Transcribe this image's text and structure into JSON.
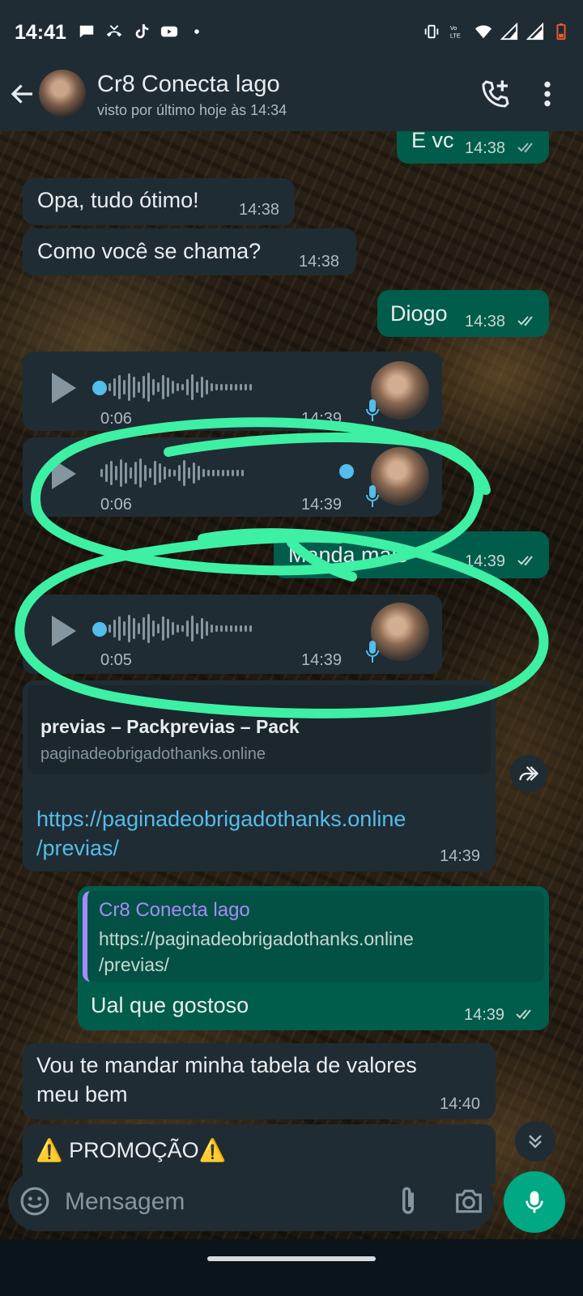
{
  "status_bar": {
    "time": "14:41"
  },
  "header": {
    "contact_name": "Cr8 Conecta lago",
    "last_seen": "visto por último hoje às 14:34"
  },
  "messages": {
    "m1": {
      "text": "E vc",
      "time": "14:38"
    },
    "m2": {
      "text": "Opa, tudo ótimo!",
      "time": "14:38"
    },
    "m3": {
      "text": "Como você se chama?",
      "time": "14:38"
    },
    "m4": {
      "text": "Diogo",
      "time": "14:38"
    },
    "v1": {
      "duration": "0:06",
      "time": "14:39",
      "played_fraction": 0
    },
    "v2": {
      "duration": "0:06",
      "time": "14:39",
      "played_fraction": 1
    },
    "m5": {
      "text": "Manda mais",
      "time": "14:39"
    },
    "v3": {
      "duration": "0:05",
      "time": "14:39",
      "played_fraction": 0
    },
    "link": {
      "preview_title": "previas – Packprevias – Pack",
      "preview_domain": "paginadeobrigadothanks.online",
      "url_line1": "https://paginadeobrigadothanks.online",
      "url_line2": "/previas/",
      "time": "14:39"
    },
    "reply": {
      "quoted_author": "Cr8 Conecta lago",
      "quoted_line1": "https://paginadeobrigadothanks.online",
      "quoted_line2": "/previas/",
      "text": "Ual que gostoso",
      "time": "14:39"
    },
    "m6": {
      "line1": "Vou te mandar minha tabela de valores",
      "line2": "meu bem",
      "time": "14:40"
    },
    "m7": {
      "text": "⚠️ PROMOÇÃO⚠️"
    }
  },
  "input": {
    "placeholder": "Mensagem"
  },
  "colors": {
    "incoming": "#202c33",
    "outgoing": "#005c4b",
    "accent": "#00a884",
    "annotation": "#3ef0a4",
    "link": "#53bdeb"
  },
  "icons": [
    "back-arrow-icon",
    "add-call-icon",
    "more-vert-icon",
    "play-icon",
    "mic-icon",
    "forward-icon",
    "emoji-icon",
    "attach-icon",
    "camera-icon",
    "chevron-down-icon"
  ]
}
